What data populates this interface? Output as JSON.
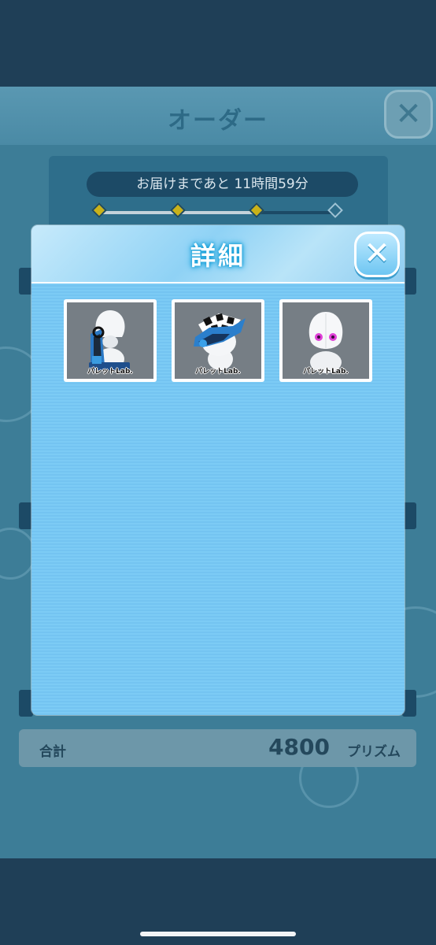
{
  "order_screen": {
    "title": "オーダー",
    "delivery_text": "お届けまであと 11時間59分",
    "progress_nodes": [
      true,
      true,
      true,
      false
    ],
    "total_label": "合計",
    "total_value": "4800",
    "total_unit": "プリズム"
  },
  "detail_modal": {
    "title": "詳細",
    "items": [
      {
        "label": "パレットLab.",
        "variant": "blue-mech-body"
      },
      {
        "label": "パレットLab.",
        "variant": "checker-hat-blue"
      },
      {
        "label": "パレットLab.",
        "variant": "white-pink-eyes"
      }
    ]
  },
  "colors": {
    "accent": "#6ec3f1",
    "title_glow": "#1aa0d8",
    "background": "#1f3f57"
  }
}
